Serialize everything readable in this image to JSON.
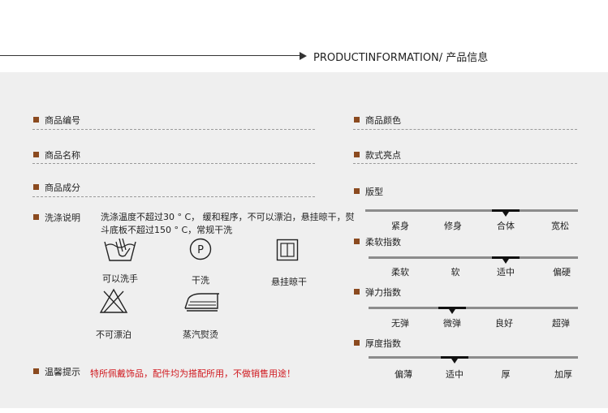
{
  "header": {
    "title": "PRODUCTINFORMATION/ 产品信息"
  },
  "left_fields": [
    {
      "label": "商品编号"
    },
    {
      "label": "商品名称"
    },
    {
      "label": "商品成分"
    }
  ],
  "wash": {
    "label": "洗涤说明",
    "text": "洗涤温度不超过30 ° C，  缓和程序，不可以漂泊，悬挂晾干，熨斗底板不超过150 ° C，常规干洗",
    "icons": [
      {
        "name": "hand-wash-icon",
        "label": "可以洗手"
      },
      {
        "name": "dry-clean-icon",
        "label": "干洗",
        "glyph": "P"
      },
      {
        "name": "line-dry-icon",
        "label": "悬挂晾干"
      },
      {
        "name": "no-bleach-icon",
        "label": "不可漂泊"
      },
      {
        "name": "steam-iron-icon",
        "label": "蒸汽熨烫"
      }
    ]
  },
  "warm_tip": {
    "label": "温馨提示",
    "text": "特所佩戴饰品，配件均为搭配所用，不做销售用途！"
  },
  "right_fields": [
    {
      "label": "商品颜色"
    },
    {
      "label": "款式亮点"
    }
  ],
  "scales": [
    {
      "label": "版型",
      "options": [
        "紧身",
        "修身",
        "合体",
        "宽松"
      ],
      "selected_index": 2
    },
    {
      "label": "柔软指数",
      "options": [
        "柔软",
        "软",
        "适中",
        "偏硬"
      ],
      "selected_index": 2
    },
    {
      "label": "弹力指数",
      "options": [
        "无弹",
        "微弹",
        "良好",
        "超弹"
      ],
      "selected_index": 1
    },
    {
      "label": "厚度指数",
      "options": [
        "偏薄",
        "适中",
        "厚",
        "加厚"
      ],
      "selected_index": 1
    }
  ],
  "colors": {
    "accent": "#8b4a1f",
    "warning": "#d0181e",
    "panel": "#efefef"
  }
}
